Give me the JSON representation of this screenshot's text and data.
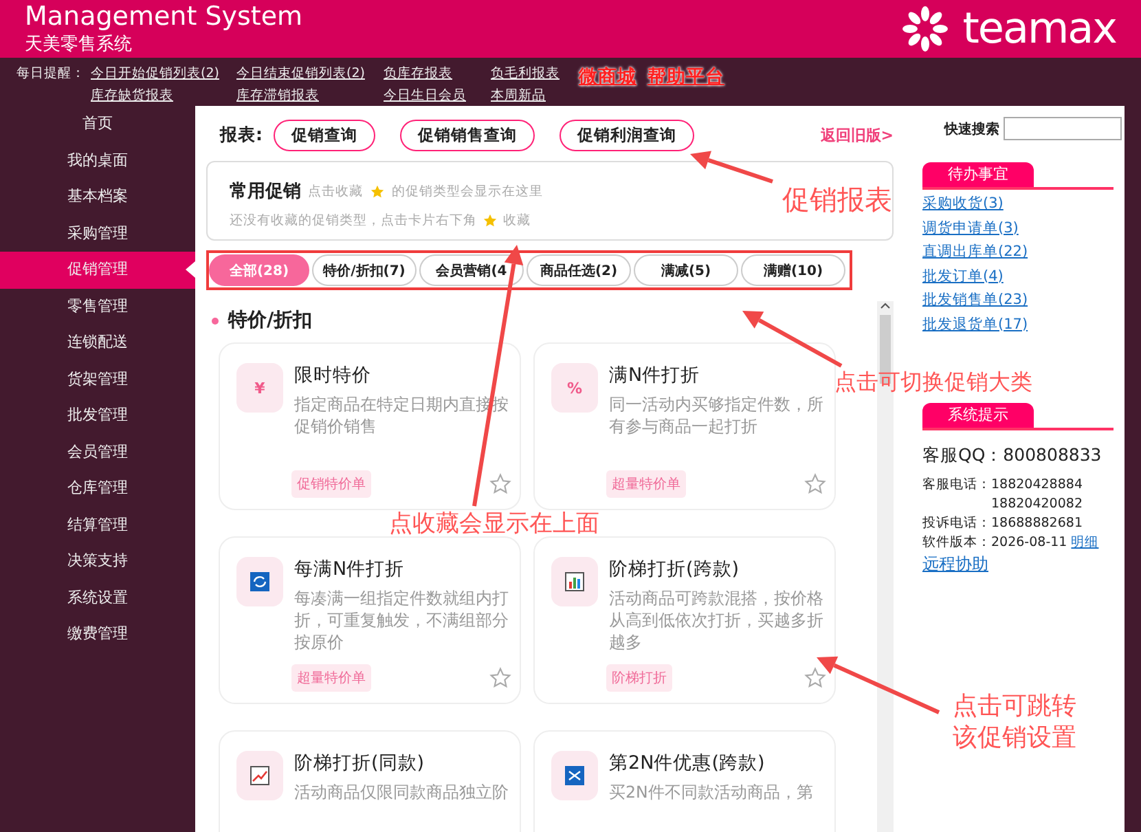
{
  "header": {
    "title": "Management System",
    "subtitle": "天美零售系统",
    "logo_text": "teamax"
  },
  "reminders": {
    "label": "每日提醒：",
    "links": [
      "今日开始促销列表(2)",
      "今日结束促销列表(2)",
      "负库存报表",
      "负毛利报表",
      "库存缺货报表",
      "库存滞销报表",
      "今日生日会员",
      "本周新品"
    ],
    "extra_links": [
      "微商城",
      "帮助平台"
    ]
  },
  "sidebar": {
    "items": [
      {
        "label": "首页",
        "selected": false
      },
      {
        "label": "我的桌面",
        "selected": false
      },
      {
        "label": "基本档案",
        "selected": false
      },
      {
        "label": "采购管理",
        "selected": false
      },
      {
        "label": "促销管理",
        "selected": true
      },
      {
        "label": "零售管理",
        "selected": false
      },
      {
        "label": "连锁配送",
        "selected": false
      },
      {
        "label": "货架管理",
        "selected": false
      },
      {
        "label": "批发管理",
        "selected": false
      },
      {
        "label": "会员管理",
        "selected": false
      },
      {
        "label": "仓库管理",
        "selected": false
      },
      {
        "label": "结算管理",
        "selected": false
      },
      {
        "label": "决策支持",
        "selected": false
      },
      {
        "label": "系统设置",
        "selected": false
      },
      {
        "label": "缴费管理",
        "selected": false
      }
    ]
  },
  "reports": {
    "label": "报表:",
    "buttons": [
      "促销查询",
      "促销销售查询",
      "促销利润查询"
    ],
    "back_link": "返回旧版>"
  },
  "favorites": {
    "title": "常用促销",
    "hint_before": "点击收藏",
    "hint_after": "的促销类型会显示在这里",
    "empty_before": "还没有收藏的促销类型，点击卡片右下角",
    "empty_after": "收藏"
  },
  "filters": [
    {
      "label": "全部(28)",
      "selected": true
    },
    {
      "label": "特价/折扣(7)",
      "selected": false
    },
    {
      "label": "会员营销(4",
      "selected": false
    },
    {
      "label": "商品任选(2)",
      "selected": false
    },
    {
      "label": "满减(5)",
      "selected": false
    },
    {
      "label": "满赠(10)",
      "selected": false
    }
  ],
  "section": {
    "title": "特价/折扣",
    "cards": [
      {
        "title": "限时特价",
        "description": "指定商品在特定日期内直接按促销价销售",
        "tag": "促销特价单",
        "favorite": false,
        "icon": {
          "kind": "glyph",
          "text": "¥"
        }
      },
      {
        "title": "满N件打折",
        "description": "同一活动内买够指定件数，所有参与商品一起打折",
        "tag": "超量特价单",
        "favorite": false,
        "icon": {
          "kind": "glyph",
          "text": "%"
        }
      },
      {
        "title": "每满N件打折",
        "description": "每凑满一组指定件数就组内打折，可重复触发，不满组部分按原价",
        "tag": "超量特价单",
        "favorite": false,
        "icon": {
          "kind": "cycle"
        }
      },
      {
        "title": "阶梯打折(跨款)",
        "description": "活动商品可跨款混搭，按价格从高到低依次打折，买越多折越多",
        "tag": "阶梯打折",
        "favorite": false,
        "icon": {
          "kind": "bars"
        }
      },
      {
        "title": "阶梯打折(同款)",
        "description": "活动商品仅限同款商品独立阶",
        "icon": {
          "kind": "trend"
        }
      },
      {
        "title": "第2N件优惠(跨款)",
        "description": "买2N件不同款活动商品，第",
        "icon": {
          "kind": "shuffle"
        }
      }
    ]
  },
  "right_panel": {
    "search_label": "快速搜索",
    "todo": {
      "title": "待办事宜",
      "items": [
        "采购收货(3)",
        "调货申请单(3)",
        "直调出库单(22)",
        "批发订单(4)",
        "批发销售单(23)",
        "批发退货单(17)"
      ]
    },
    "notice": {
      "title": "系统提示",
      "qq": "客服QQ：800808833",
      "phone_label": "客服电话：",
      "phones": [
        "18820428884",
        "18820420082"
      ],
      "complaint": "投诉电话：18688882681",
      "version": "软件版本：2026-08-11",
      "version_link": "明细",
      "remote": "远程协助"
    }
  },
  "annotations": [
    "促销报表",
    "点击可切换促销大类",
    "点收藏会显示在上面",
    "点击可跳转该促销设置"
  ]
}
